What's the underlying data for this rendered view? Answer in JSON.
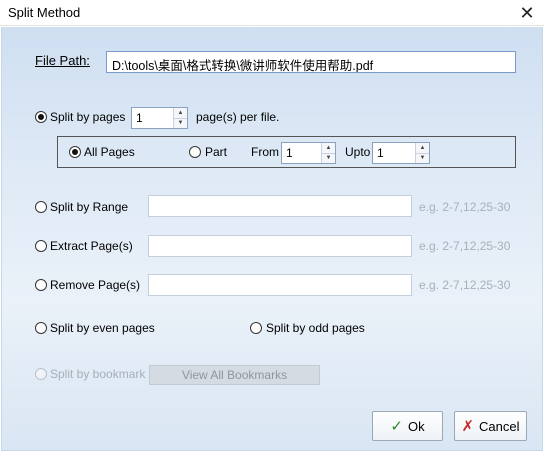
{
  "window": {
    "title": "Split Method"
  },
  "file_path": {
    "label": "File Path:",
    "value": "D:\\tools\\桌面\\格式转换\\微讲师软件使用帮助.pdf"
  },
  "split_by_pages": {
    "label": "Split by pages",
    "value": "1",
    "suffix": "page(s) per file.",
    "checked": true
  },
  "page_options": {
    "all_pages_label": "All Pages",
    "part_label": "Part",
    "from_label": "From",
    "from_value": "1",
    "upto_label": "Upto",
    "upto_value": "1"
  },
  "split_by_range": {
    "label": "Split by Range",
    "value": "",
    "hint": "e.g. 2-7,12,25-30"
  },
  "extract_pages": {
    "label": "Extract Page(s)",
    "value": "",
    "hint": "e.g. 2-7,12,25-30"
  },
  "remove_pages": {
    "label": "Remove Page(s)",
    "value": "",
    "hint": "e.g. 2-7,12,25-30"
  },
  "even_pages": {
    "label": "Split by even pages"
  },
  "odd_pages": {
    "label": "Split by odd pages"
  },
  "bookmark": {
    "label": "Split by bookmark",
    "button_label": "View All Bookmarks"
  },
  "buttons": {
    "ok_label": "Ok",
    "cancel_label": "Cancel"
  },
  "icons": {
    "close": "close-icon",
    "ok": "check-icon",
    "cancel": "x-icon"
  }
}
